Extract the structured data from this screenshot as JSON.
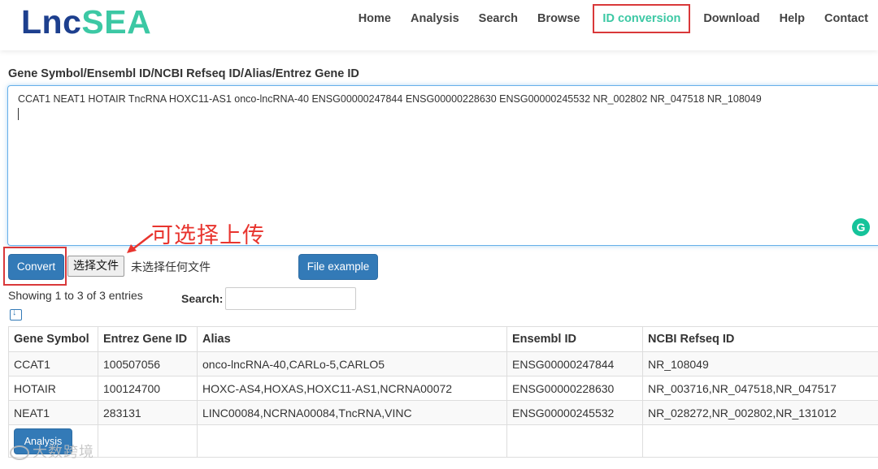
{
  "logo": {
    "part1": "Lnc",
    "part2": "SEA"
  },
  "nav": {
    "items": [
      {
        "label": "Home"
      },
      {
        "label": "Analysis"
      },
      {
        "label": "Search"
      },
      {
        "label": "Browse"
      },
      {
        "label": "ID conversion"
      },
      {
        "label": "Download"
      },
      {
        "label": "Help"
      },
      {
        "label": "Contact"
      }
    ],
    "active": "ID conversion"
  },
  "input": {
    "label": "Gene Symbol/Ensembl ID/NCBI Refseq ID/Alias/Entrez Gene ID",
    "value": "CCAT1 NEAT1 HOTAIR TncRNA HOXC11-AS1 onco-lncRNA-40 ENSG00000247844 ENSG00000228630 ENSG00000245532 NR_002802 NR_047518 NR_108049"
  },
  "annotation": {
    "text": "可选择上传"
  },
  "buttons": {
    "convert": "Convert",
    "choose_file": "选择文件",
    "no_file": "未选择任何文件",
    "file_example": "File example",
    "analysis": "Analysis"
  },
  "table_controls": {
    "entries_info": "Showing 1 to 3 of 3 entries",
    "search_label": "Search:"
  },
  "table": {
    "headers": [
      "Gene Symbol",
      "Entrez Gene ID",
      "Alias",
      "Ensembl ID",
      "NCBI Refseq ID"
    ],
    "rows": [
      [
        "CCAT1",
        "100507056",
        "onco-lncRNA-40,CARLo-5,CARLO5",
        "ENSG00000247844",
        "NR_108049"
      ],
      [
        "HOTAIR",
        "100124700",
        "HOXC-AS4,HOXAS,HOXC11-AS1,NCRNA00072",
        "ENSG00000228630",
        "NR_003716,NR_047518,NR_047517"
      ],
      [
        "NEAT1",
        "283131",
        "LINC00084,NCRNA00084,TncRNA,VINC",
        "ENSG00000245532",
        "NR_028272,NR_002802,NR_131012"
      ]
    ]
  },
  "watermark": {
    "text": "大数跨境"
  },
  "colors": {
    "brand_dark": "#1d3f8e",
    "brand_accent": "#3cc8a4",
    "primary_button": "#337ab7",
    "annotation_red": "#e8342e"
  }
}
